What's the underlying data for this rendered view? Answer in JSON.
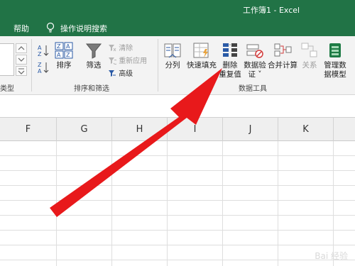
{
  "window": {
    "title": "工作簿1  -  Excel"
  },
  "menu": {
    "help_label": "帮助",
    "tell_me_label": "操作说明搜索",
    "tell_me_icon": "lightbulb-icon"
  },
  "ribbon": {
    "left_group_partial_label": "类型",
    "sort_filter_group": {
      "label": "排序和筛选",
      "sort_label": "排序",
      "filter_label": "筛选",
      "clear_label": "清除",
      "reapply_label": "重新应用",
      "advanced_label": "高级"
    },
    "data_tools_group": {
      "label": "数据工具",
      "text_to_columns_label": "分列",
      "flash_fill_label": "快速填充",
      "remove_duplicates_label_line1": "删除",
      "remove_duplicates_label_line2": "重复值",
      "data_validation_label_line1": "数据验",
      "data_validation_label_line2": "证 ˅",
      "consolidate_label": "合并计算",
      "relationships_label": "关系",
      "manage_model_label_line1": "管理数",
      "manage_model_label_line2": "据模型"
    }
  },
  "sheet": {
    "columns": [
      "F",
      "G",
      "H",
      "I",
      "J",
      "K"
    ]
  },
  "annotation": {
    "arrow_color": "#e8191b"
  },
  "watermark": {
    "text": "Bai 经验"
  },
  "colors": {
    "excel_green": "#217346",
    "ribbon_bg": "#f3f3f3"
  }
}
